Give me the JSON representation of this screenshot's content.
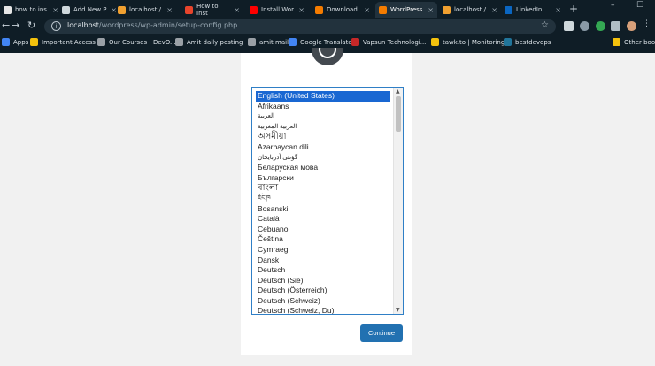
{
  "browser": {
    "tabs": [
      {
        "label": "how to ins",
        "color": "#e6e6e6"
      },
      {
        "label": "Add New P",
        "color": "#cfd8dc"
      },
      {
        "label": "localhost /",
        "color": "#f0a030"
      },
      {
        "label": "How to Inst",
        "color": "#e8452c"
      },
      {
        "label": "Install Wor",
        "color": "#ff0000"
      },
      {
        "label": "Download",
        "color": "#f57c00"
      },
      {
        "label": "WordPress",
        "color": "#f57c00"
      },
      {
        "label": "localhost /",
        "color": "#f0a030"
      },
      {
        "label": "LinkedIn",
        "color": "#0a66c2"
      }
    ],
    "new_tab": "+",
    "window_controls": {
      "minimize": "–",
      "maximize": "☐"
    },
    "url_host": "localhost",
    "url_path": "/wordpress/wp-admin/setup-config.php",
    "bookmarks": [
      {
        "label": "Apps",
        "color": "#4285f4"
      },
      {
        "label": "Important Access",
        "color": "#f4c20d"
      },
      {
        "label": "Our Courses | DevO...",
        "color": "#9aa0a6"
      },
      {
        "label": "Amit daily posting",
        "color": "#9aa0a6"
      },
      {
        "label": "amit mail",
        "color": "#9aa0a6"
      },
      {
        "label": "Google Translate",
        "color": "#4285f4"
      },
      {
        "label": "Vapsun Technologi...",
        "color": "#c62828"
      },
      {
        "label": "tawk.to | Monitoring",
        "color": "#f4c20d"
      },
      {
        "label": "bestdevops",
        "color": "#21759b"
      },
      {
        "label": "Other bookm",
        "color": "#f4c20d"
      }
    ]
  },
  "setup": {
    "languages": [
      "English (United States)",
      "Afrikaans",
      "العربية",
      "العربية المغربية",
      "অসমীয়া",
      "Azərbaycan dili",
      "گؤنئی آذربایجان",
      "Беларуская мова",
      "Български",
      "বাংলা",
      "ཇོང་ཁ",
      "Bosanski",
      "Català",
      "Cebuano",
      "Čeština",
      "Cymraeg",
      "Dansk",
      "Deutsch",
      "Deutsch (Sie)",
      "Deutsch (Österreich)",
      "Deutsch (Schweiz)",
      "Deutsch (Schweiz, Du)"
    ],
    "selected_index": 0,
    "continue_label": "Continue"
  },
  "colors": {
    "accent": "#2271b1",
    "selection": "#1967d2",
    "chrome_bg": "#0f1d26"
  }
}
